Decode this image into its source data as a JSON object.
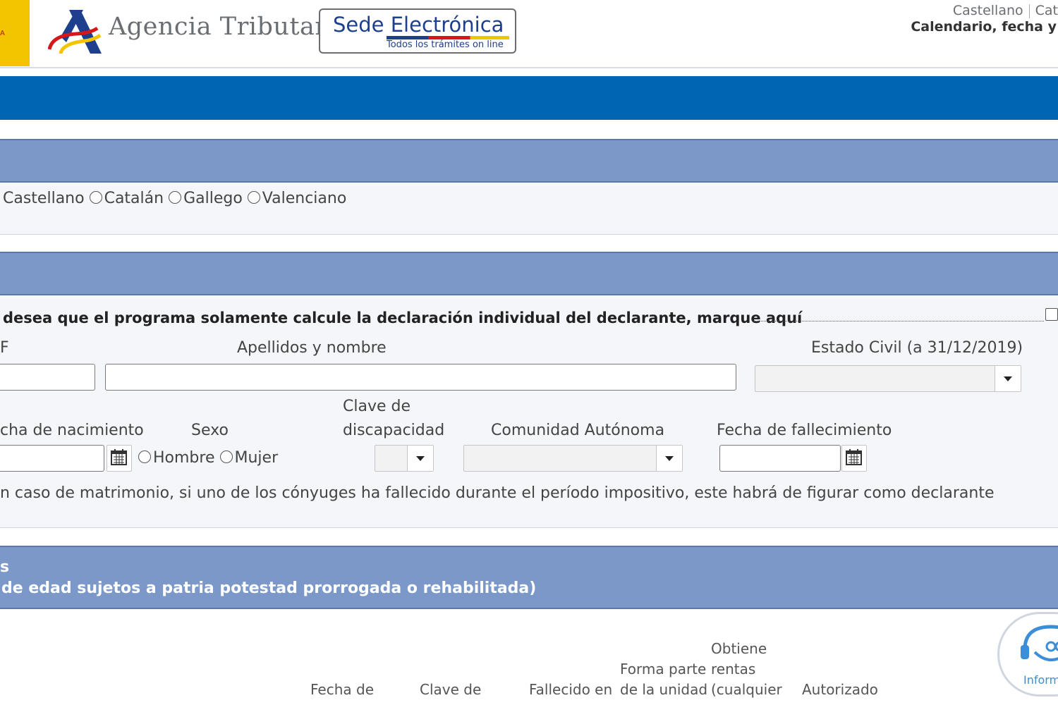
{
  "header": {
    "gov_logo_text": "A",
    "brand": "Agencia Tributaria",
    "sede_title": "Sede Electrónica",
    "sede_subtitle": "Todos los trámites on line",
    "lang_links": [
      "Castellano",
      "Cat"
    ],
    "calendar_link": "Calendario, fecha y"
  },
  "language_section": {
    "options": [
      "Castellano",
      "Catalán",
      "Gallego",
      "Valenciano"
    ],
    "selected": "Castellano"
  },
  "declarant_section": {
    "individual_check_text": "desea que el programa solamente calcule la declaración individual del declarante, marque aquí",
    "nif_label": "F",
    "name_label": "Apellidos y nombre",
    "civil_status_label": "Estado Civil (a 31/12/2019)",
    "birth_label": "cha de nacimiento",
    "sex_label": "Sexo",
    "sex_options": [
      "Hombre",
      "Mujer"
    ],
    "disability_label_1": "Clave de",
    "disability_label_2": "discapacidad",
    "community_label": "Comunidad Autónoma",
    "death_label": "Fecha de fallecimiento",
    "note": "n caso de matrimonio, si uno de los cónyuges ha fallecido durante el período impositivo, este habrá de figurar como declarante"
  },
  "children_section": {
    "title_1": "s",
    "title_2": "de edad sujetos a patria potestad prorrogada o rehabilitada)",
    "columns": {
      "birth": "Fecha de",
      "key": "Clave de",
      "deceased": "Fallecido en",
      "unit": [
        "Forma parte",
        "de la unidad"
      ],
      "income": [
        "Obtiene",
        "rentas",
        "(cualquier"
      ],
      "authorized": "Autorizado"
    },
    "help_label": "Inform"
  }
}
